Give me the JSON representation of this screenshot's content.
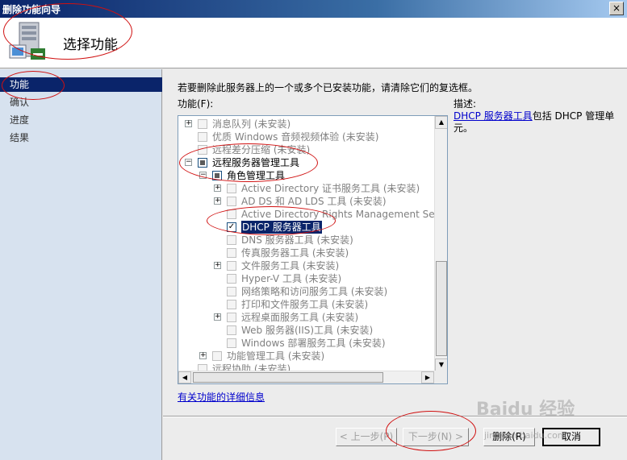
{
  "window": {
    "title": "删除功能向导",
    "close_label": "×"
  },
  "header": {
    "heading": "选择功能"
  },
  "nav": {
    "steps": [
      "功能",
      "确认",
      "进度",
      "结果"
    ]
  },
  "main": {
    "instruction": "若要删除此服务器上的一个或多个已安装功能，请清除它们的复选框。",
    "features_label": "功能(F):",
    "description_label": "描述:",
    "description_link": "DHCP 服务器工具",
    "description_text": "包括 DHCP 管理单元。",
    "more_info_link": "有关功能的详细信息"
  },
  "tree": {
    "items": [
      {
        "label": "消息队列  (未安装)",
        "expander": "+",
        "checkbox": "off"
      },
      {
        "label": "优质 Windows 音频视频体验  (未安装)",
        "expander": "",
        "checkbox": "off"
      },
      {
        "label": "远程差分压缩  (未安装)",
        "expander": "",
        "checkbox": "off"
      },
      {
        "label": "远程服务器管理工具",
        "expander": "−",
        "checkbox": "partial"
      },
      {
        "label": "角色管理工具",
        "expander": "−",
        "checkbox": "partial"
      },
      {
        "label": "Active Directory 证书服务工具  (未安装)",
        "expander": "+",
        "checkbox": "off"
      },
      {
        "label": "AD DS 和 AD LDS 工具  (未安装)",
        "expander": "+",
        "checkbox": "off"
      },
      {
        "label": "Active Directory Rights Management Serv",
        "expander": "",
        "checkbox": "off"
      },
      {
        "label": "DHCP 服务器工具",
        "expander": "",
        "checkbox": "checked"
      },
      {
        "label": "DNS 服务器工具  (未安装)",
        "expander": "",
        "checkbox": "off"
      },
      {
        "label": "传真服务器工具  (未安装)",
        "expander": "",
        "checkbox": "off"
      },
      {
        "label": "文件服务工具  (未安装)",
        "expander": "+",
        "checkbox": "off"
      },
      {
        "label": "Hyper-V 工具  (未安装)",
        "expander": "",
        "checkbox": "off"
      },
      {
        "label": "网络策略和访问服务工具  (未安装)",
        "expander": "",
        "checkbox": "off"
      },
      {
        "label": "打印和文件服务工具  (未安装)",
        "expander": "",
        "checkbox": "off"
      },
      {
        "label": "远程桌面服务工具  (未安装)",
        "expander": "+",
        "checkbox": "off"
      },
      {
        "label": "Web 服务器(IIS)工具  (未安装)",
        "expander": "",
        "checkbox": "off"
      },
      {
        "label": "Windows 部署服务工具  (未安装)",
        "expander": "",
        "checkbox": "off"
      },
      {
        "label": "功能管理工具  (未安装)",
        "expander": "+",
        "checkbox": "off"
      },
      {
        "label": "远程协助  (未安装)",
        "expander": "",
        "checkbox": "off"
      }
    ]
  },
  "buttons": {
    "prev": "< 上一步(P)",
    "next": "下一步(N) >",
    "remove": "删除(R)",
    "cancel": "取消"
  },
  "watermark": {
    "text": "Baidu 经验",
    "sub": "jingyan.baidu.com"
  },
  "colors": {
    "selection": "#0a246a",
    "link": "#0000cc",
    "annotation": "#d01010",
    "nav_bg": "#d7e2ef"
  }
}
